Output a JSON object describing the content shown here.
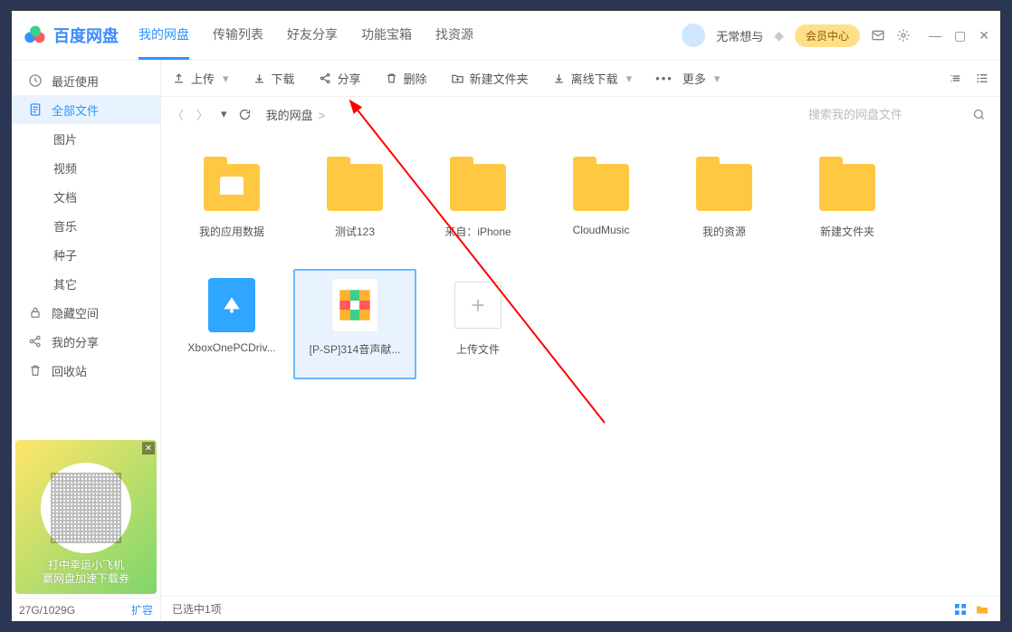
{
  "app": {
    "name": "百度网盘"
  },
  "header": {
    "tabs": [
      "我的网盘",
      "传输列表",
      "好友分享",
      "功能宝箱",
      "找资源"
    ],
    "active_tab": 0,
    "username": "无常想与",
    "member_btn": "会员中心"
  },
  "sidebar": {
    "items": [
      {
        "label": "最近使用",
        "icon": "clock"
      },
      {
        "label": "全部文件",
        "icon": "file",
        "active": true
      },
      {
        "label": "图片",
        "sub": true
      },
      {
        "label": "视频",
        "sub": true
      },
      {
        "label": "文档",
        "sub": true
      },
      {
        "label": "音乐",
        "sub": true
      },
      {
        "label": "种子",
        "sub": true
      },
      {
        "label": "其它",
        "sub": true
      },
      {
        "label": "隐藏空间",
        "icon": "lock"
      },
      {
        "label": "我的分享",
        "icon": "share"
      },
      {
        "label": "回收站",
        "icon": "trash"
      }
    ],
    "promo": {
      "line1": "打中幸运小飞机",
      "line2": "赢网盘加速下载券"
    },
    "storage_used": "27G/1029G",
    "expand": "扩容"
  },
  "toolbar": {
    "upload": "上传",
    "download": "下载",
    "share": "分享",
    "delete": "删除",
    "newfolder": "新建文件夹",
    "offline": "离线下载",
    "more": "更多"
  },
  "breadcrumb": {
    "root": "我的网盘"
  },
  "search": {
    "placeholder": "搜索我的网盘文件"
  },
  "grid": {
    "items": [
      {
        "label": "我的应用数据",
        "type": "folder-app"
      },
      {
        "label": "测试123",
        "type": "folder"
      },
      {
        "label": "来自：iPhone",
        "type": "folder"
      },
      {
        "label": "CloudMusic",
        "type": "folder"
      },
      {
        "label": "我的资源",
        "type": "folder"
      },
      {
        "label": "新建文件夹",
        "type": "folder"
      },
      {
        "label": "XboxOnePCDriv...",
        "type": "file-blue"
      },
      {
        "label": "[P-SP]314音声献...",
        "type": "file-color",
        "selected": true
      },
      {
        "label": "上传文件",
        "type": "upload"
      }
    ]
  },
  "status": {
    "selection": "已选中1项"
  }
}
